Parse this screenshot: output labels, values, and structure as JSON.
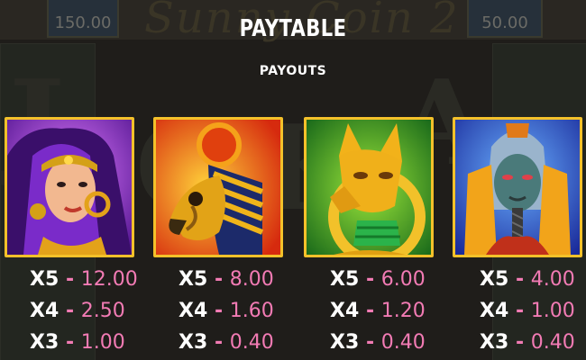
{
  "header": {
    "title": "PAYTABLE",
    "subtitle": "PAYOUTS",
    "bg_left_value": "150.00",
    "bg_right_value": "50.00"
  },
  "colors": {
    "accent_pink": "#f27bb4",
    "frame_gold": "#f4c12a",
    "text_white": "#ffffff"
  },
  "symbols": [
    {
      "name": "cleopatra-symbol",
      "icon": "queen-icon",
      "payouts": [
        {
          "mult": "X5",
          "value": "12.00"
        },
        {
          "mult": "X4",
          "value": "2.50"
        },
        {
          "mult": "X3",
          "value": "1.00"
        }
      ]
    },
    {
      "name": "horus-symbol",
      "icon": "falcon-icon",
      "payouts": [
        {
          "mult": "X5",
          "value": "8.00"
        },
        {
          "mult": "X4",
          "value": "1.60"
        },
        {
          "mult": "X3",
          "value": "0.40"
        }
      ]
    },
    {
      "name": "bastet-symbol",
      "icon": "cat-icon",
      "payouts": [
        {
          "mult": "X5",
          "value": "6.00"
        },
        {
          "mult": "X4",
          "value": "1.20"
        },
        {
          "mult": "X3",
          "value": "0.40"
        }
      ]
    },
    {
      "name": "osiris-symbol",
      "icon": "pharaoh-icon",
      "payouts": [
        {
          "mult": "X5",
          "value": "4.00"
        },
        {
          "mult": "X4",
          "value": "1.00"
        },
        {
          "mult": "X3",
          "value": "0.40"
        }
      ]
    }
  ]
}
